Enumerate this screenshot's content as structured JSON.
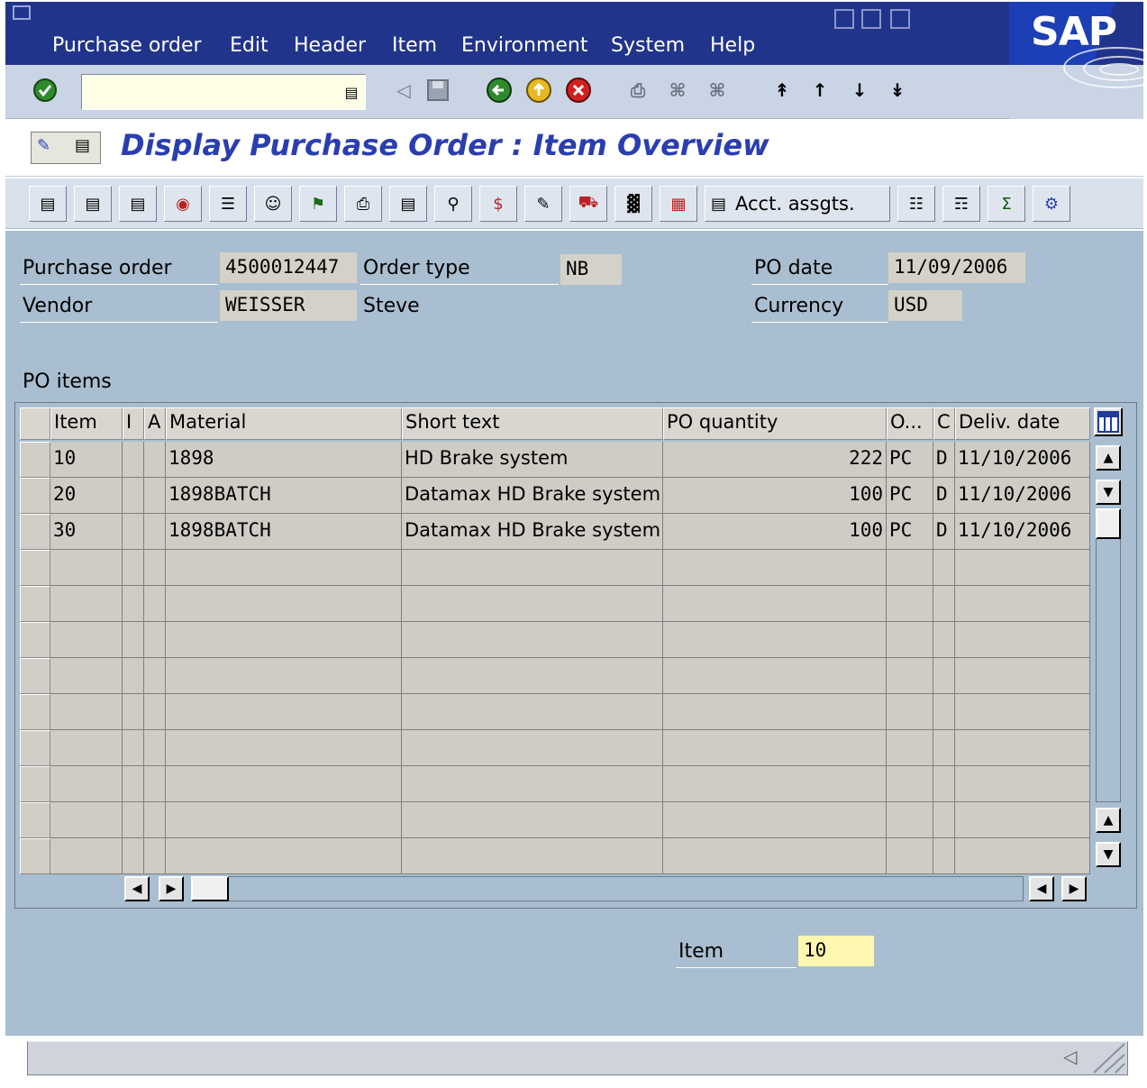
{
  "menu": {
    "items": [
      "Purchase order",
      "Edit",
      "Header",
      "Item",
      "Environment",
      "System",
      "Help"
    ]
  },
  "brand": {
    "logo_text": "SAP"
  },
  "standard_toolbar": {
    "command_field_value": "",
    "icons": [
      "enter-icon",
      "command-dropdown-icon",
      "back-arrow-icon",
      "save-icon",
      "back-icon",
      "exit-icon",
      "cancel-icon",
      "print-icon",
      "find-icon",
      "find-next-icon",
      "first-page-icon",
      "previous-page-icon",
      "next-page-icon",
      "last-page-icon"
    ]
  },
  "title": {
    "text": "Display Purchase Order : Item Overview"
  },
  "app_toolbar": {
    "acct_button_label": "Acct. assgts."
  },
  "header": {
    "purchase_order_label": "Purchase order",
    "purchase_order_value": "4500012447",
    "order_type_label": "Order type",
    "order_type_value": "NB",
    "po_date_label": "PO date",
    "po_date_value": "11/09/2006",
    "vendor_label": "Vendor",
    "vendor_value": "WEISSER",
    "vendor_name": "Steve",
    "currency_label": "Currency",
    "currency_value": "USD"
  },
  "items_table": {
    "section_label": "PO items",
    "columns": [
      "Item",
      "I",
      "A",
      "Material",
      "Short text",
      "PO quantity",
      "O...",
      "C",
      "Deliv. date"
    ],
    "rows": [
      {
        "item": "10",
        "i": "",
        "a": "",
        "material": "1898",
        "short_text": "HD Brake system",
        "qty": "222",
        "uom": "PC",
        "c": "D",
        "deliv_date": "11/10/2006"
      },
      {
        "item": "20",
        "i": "",
        "a": "",
        "material": "1898BATCH",
        "short_text": "Datamax HD Brake system",
        "qty": "100",
        "uom": "PC",
        "c": "D",
        "deliv_date": "11/10/2006"
      },
      {
        "item": "30",
        "i": "",
        "a": "",
        "material": "1898BATCH",
        "short_text": "Datamax HD Brake system",
        "qty": "100",
        "uom": "PC",
        "c": "D",
        "deliv_date": "11/10/2006"
      }
    ]
  },
  "footer": {
    "item_label": "Item",
    "item_value": "10"
  },
  "colors": {
    "menubar": "#21348c",
    "title_text": "#2a3eb0",
    "workarea": "#a9bed0",
    "highlight_field": "#fff7b0"
  }
}
